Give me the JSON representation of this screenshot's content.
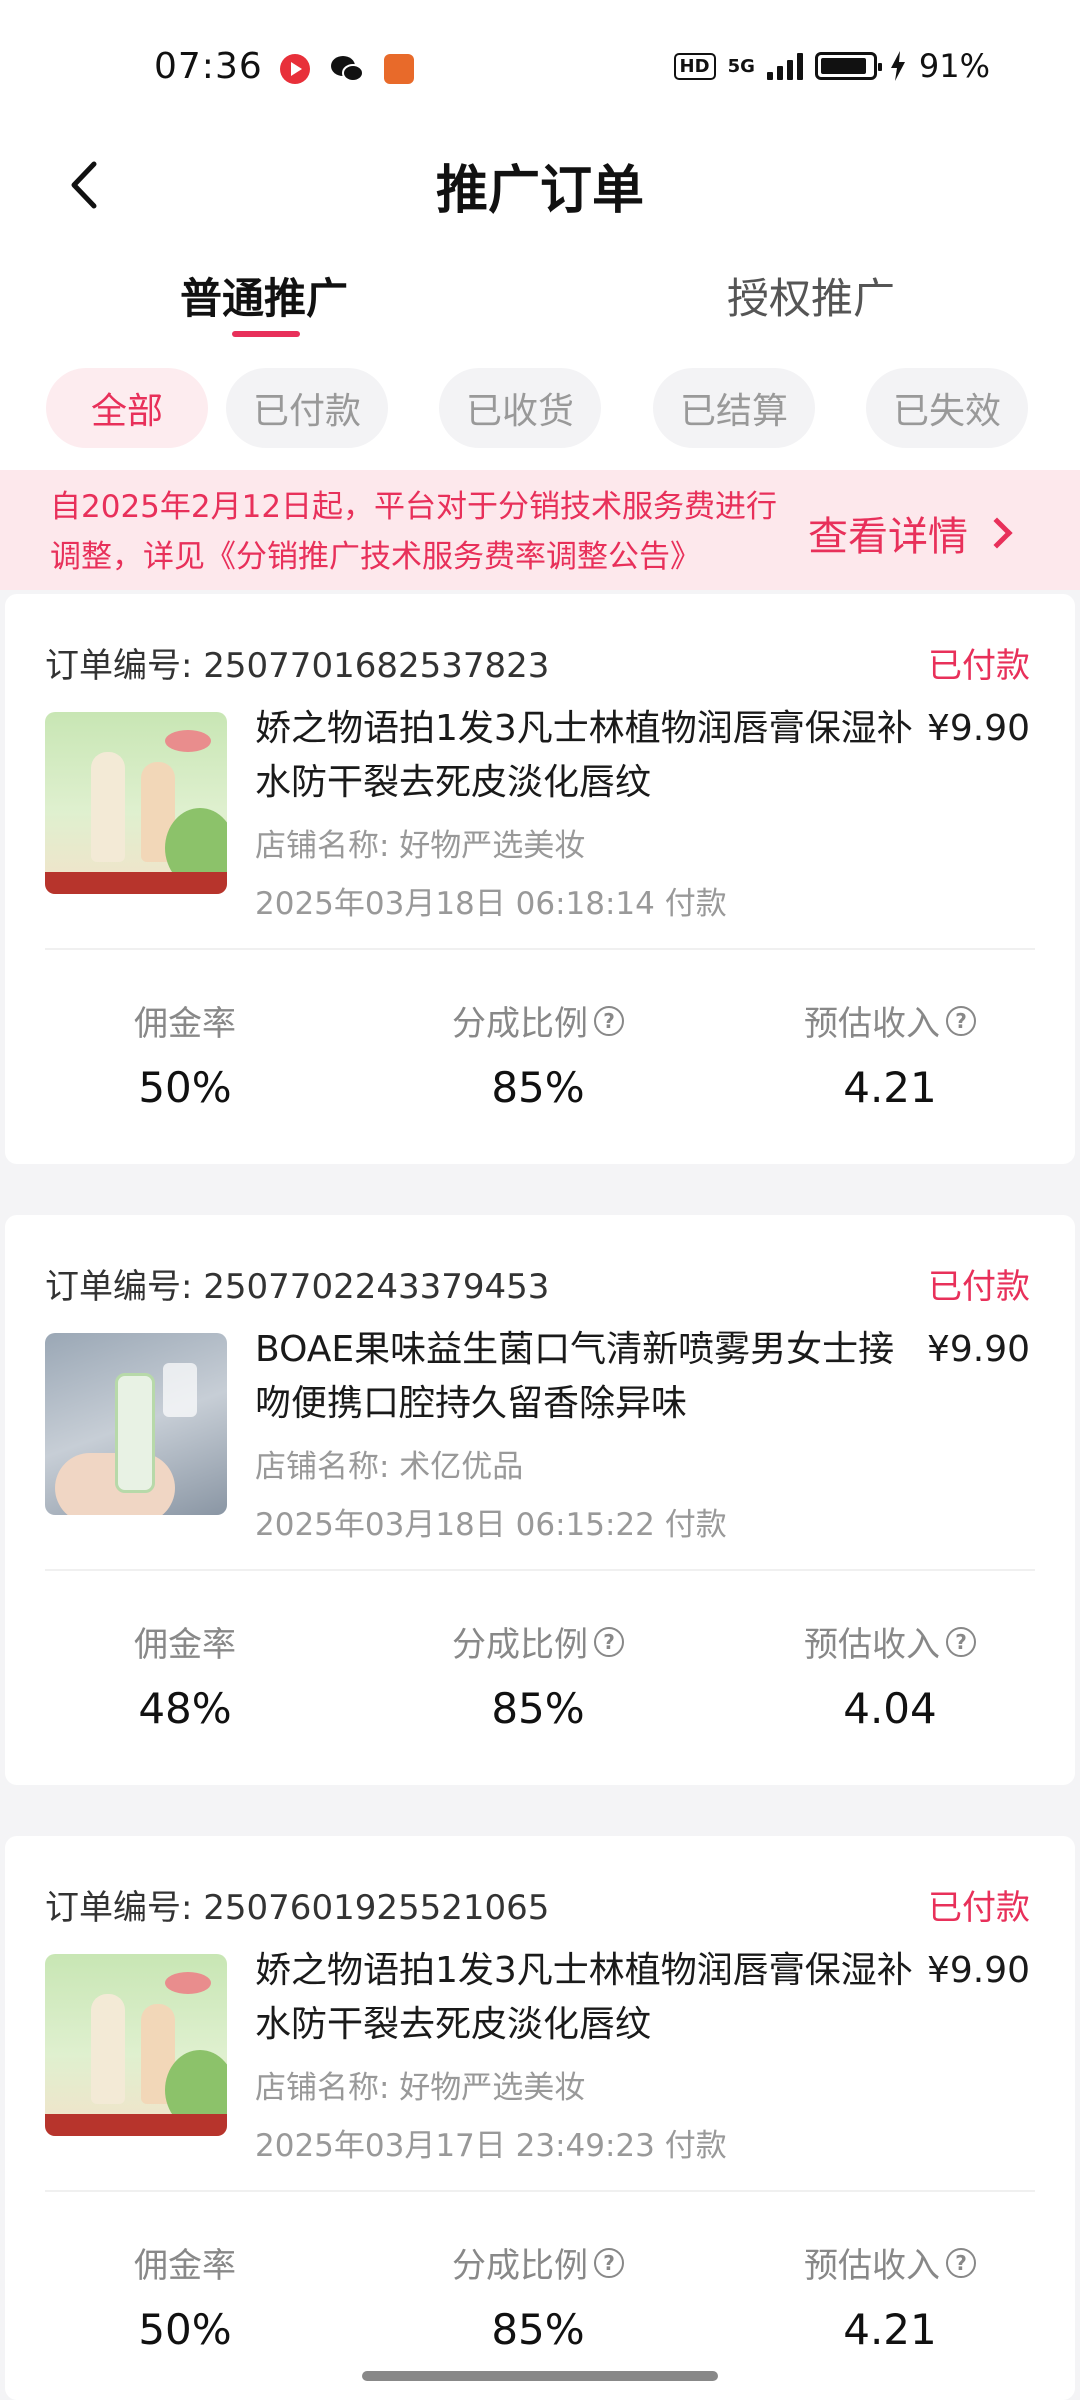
{
  "status_bar": {
    "time": "07:36",
    "network": "5G",
    "hd": "HD",
    "battery": "91%",
    "battery_level": 0.91,
    "app_icons": [
      "video-app-icon",
      "wechat-icon",
      "mascot-app-icon"
    ]
  },
  "header": {
    "title": "推广订单",
    "back_icon": "chevron-left-icon"
  },
  "main_tabs": [
    {
      "label": "普通推广",
      "active": true
    },
    {
      "label": "授权推广",
      "active": false
    }
  ],
  "filters": [
    {
      "label": "全部",
      "active": true
    },
    {
      "label": "已付款",
      "active": false
    },
    {
      "label": "已收货",
      "active": false
    },
    {
      "label": "已结算",
      "active": false
    },
    {
      "label": "已失效",
      "active": false
    }
  ],
  "notice": {
    "text": "自2025年2月12日起，平台对于分销技术服务费进行调整，详见《分销推广技术服务费率调整公告》",
    "link": "查看详情"
  },
  "stat_labels": {
    "commission_rate": "佣金率",
    "share_ratio": "分成比例",
    "estimated_income": "预估收入"
  },
  "orders": [
    {
      "order_no_label": "订单编号:",
      "order_no": "2507701682537823",
      "status": "已付款",
      "title": "娇之物语拍1发3凡士林植物润唇膏保湿补水防干裂去死皮淡化唇纹",
      "price": "¥9.90",
      "store": "店铺名称: 好物严选美妆",
      "pay_time": "2025年03月18日 06:18:14 付款",
      "commission_rate": "50%",
      "share_ratio": "85%",
      "estimated_income": "4.21"
    },
    {
      "order_no_label": "订单编号:",
      "order_no": "2507702243379453",
      "status": "已付款",
      "title": "BOAE果味益生菌口气清新喷雾男女士接吻便携口腔持久留香除异味",
      "price": "¥9.90",
      "store": "店铺名称: 术亿优品",
      "pay_time": "2025年03月18日 06:15:22 付款",
      "commission_rate": "48%",
      "share_ratio": "85%",
      "estimated_income": "4.04"
    },
    {
      "order_no_label": "订单编号:",
      "order_no": "2507601925521065",
      "status": "已付款",
      "title": "娇之物语拍1发3凡士林植物润唇膏保湿补水防干裂去死皮淡化唇纹",
      "price": "¥9.90",
      "store": "店铺名称: 好物严选美妆",
      "pay_time": "2025年03月17日 23:49:23 付款",
      "commission_rate": "50%",
      "share_ratio": "85%",
      "estimated_income": "4.21"
    }
  ],
  "colors": {
    "accent": "#e8305a",
    "notice_bg": "#fde8ec",
    "page_bg": "#f4f4f6"
  }
}
